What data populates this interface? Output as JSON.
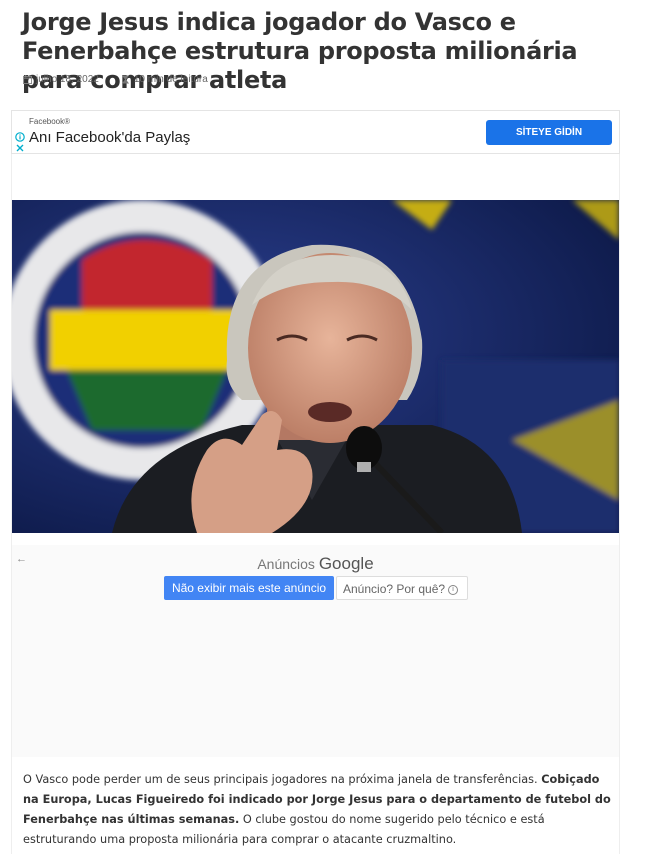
{
  "article": {
    "title": "Jorge Jesus indica jogador do Vasco e Fenerbahçe estrutura proposta milionária para comprar atleta",
    "date": "julho 18, 2022",
    "read_time": "10 min de leitura",
    "body_part1": "O Vasco pode perder um de seus principais jogadores na próxima janela de transferências. ",
    "body_bold": "Cobiçado na Europa, Lucas Figueiredo foi indicado por Jorge Jesus para o departamento de futebol do Fenerbahçe nas últimas semanas.",
    "body_part2": " O clube gostou do nome sugerido pelo técnico e está estruturando uma proposta milionária para comprar o atacante cruzmaltino."
  },
  "ad_banner": {
    "sponsor": "Facebook®",
    "headline": "Anı Facebook'da Paylaş",
    "cta": "SİTEYE GİDİN"
  },
  "google_ad": {
    "ads_label": "Anúncios",
    "google_label": "Google",
    "hide_button": "Não exibir mais este anúncio",
    "why_button": "Anúncio? Por quê?"
  },
  "icons": {
    "calendar": "calendar-icon",
    "hourglass": "hourglass-icon",
    "info": "info-icon",
    "close": "close-icon",
    "back": "back-arrow-icon"
  },
  "colors": {
    "cta_blue": "#1a73e8",
    "google_blue": "#4285f4",
    "title": "#333333"
  }
}
